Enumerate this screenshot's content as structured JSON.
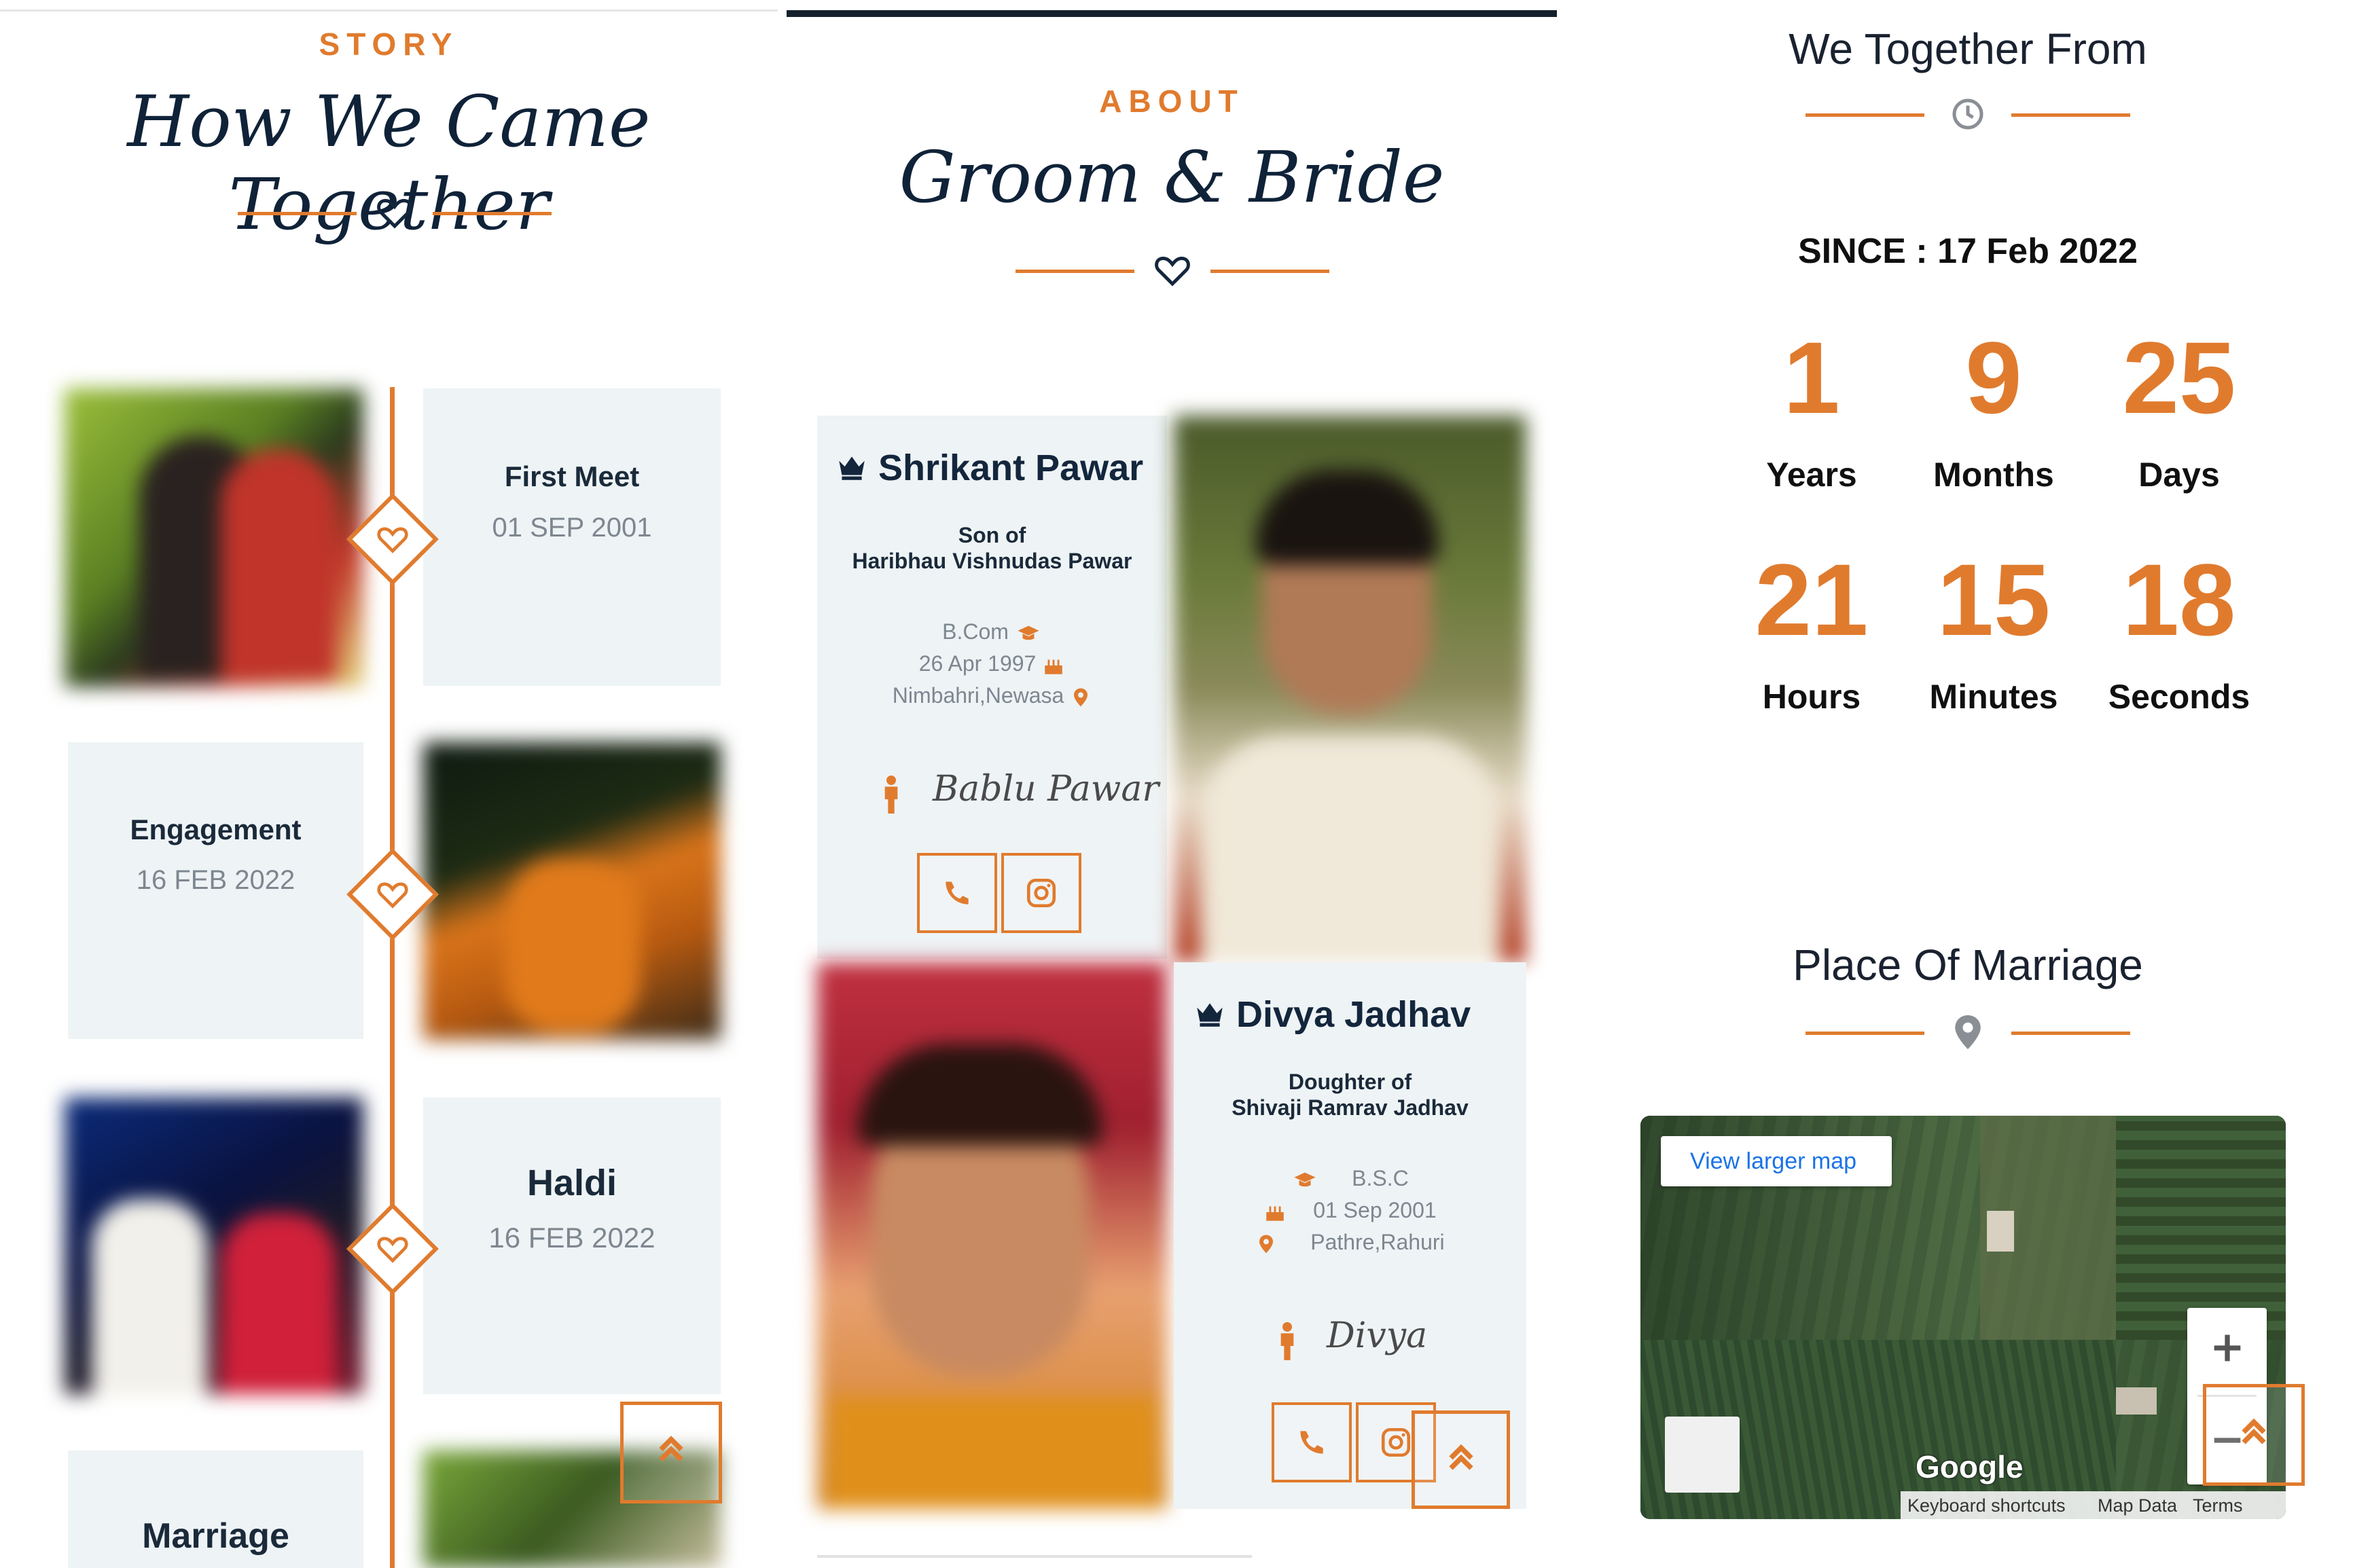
{
  "story": {
    "kicker": "STORY",
    "title": "How We Came Together",
    "events": [
      {
        "title": "First Meet",
        "date": "01 SEP 2001"
      },
      {
        "title": "Engagement",
        "date": "16 FEB 2022"
      },
      {
        "title": "Haldi",
        "date": "16 FEB 2022"
      },
      {
        "title": "Marriage",
        "date": ""
      }
    ]
  },
  "about": {
    "kicker": "ABOUT",
    "title": "Groom & Bride",
    "groom": {
      "name": "Shrikant Pawar",
      "relation": "Son of",
      "parent": "Haribhau Vishnudas Pawar",
      "education": "B.Com",
      "dob": "26 Apr 1997",
      "place": "Nimbahri,Newasa",
      "signature": "Bablu Pawar"
    },
    "bride": {
      "name": "Divya Jadhav",
      "relation": "Doughter of",
      "parent": "Shivaji Ramrav Jadhav",
      "education": "B.S.C",
      "dob": "01 Sep 2001",
      "place": "Pathre,Rahuri",
      "signature": "Divya"
    }
  },
  "together": {
    "title": "We Together From",
    "since": "SINCE : 17 Feb 2022",
    "counters": [
      {
        "value": "1",
        "label": "Years"
      },
      {
        "value": "9",
        "label": "Months"
      },
      {
        "value": "25",
        "label": "Days"
      },
      {
        "value": "21",
        "label": "Hours"
      },
      {
        "value": "15",
        "label": "Minutes"
      },
      {
        "value": "18",
        "label": "Seconds"
      }
    ]
  },
  "place": {
    "title": "Place Of Marriage",
    "map": {
      "view_larger": "View larger map",
      "brand": "Google",
      "keyboard": "Keyboard shortcuts",
      "map_data": "Map Data",
      "terms": "Terms"
    }
  },
  "colors": {
    "accent": "#e07b2e",
    "navy": "#13263c",
    "card": "#eef3f5"
  },
  "icons": [
    "heart-icon",
    "clock-icon",
    "map-pin-icon",
    "crown-icon",
    "phone-icon",
    "instagram-icon",
    "chevron-up-icon",
    "graduation-cap-icon",
    "birthday-cake-icon",
    "person-icon"
  ]
}
